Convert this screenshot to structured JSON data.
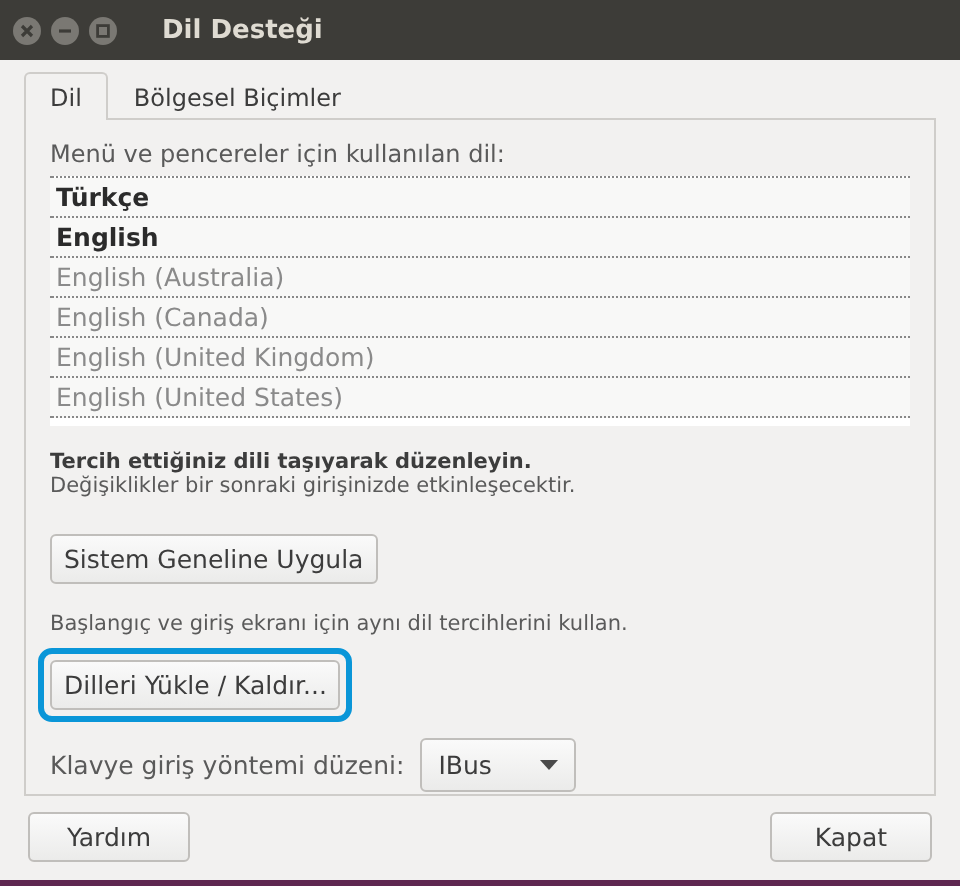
{
  "window": {
    "title": "Dil Desteği"
  },
  "tabs": [
    {
      "label": "Dil",
      "selected": true
    },
    {
      "label": "Bölgesel Biçimler",
      "selected": false
    }
  ],
  "language_list": {
    "label": "Menü ve pencereler için kullanılan dil:",
    "items": [
      {
        "name": "Türkçe",
        "active": true
      },
      {
        "name": "English",
        "active": true
      },
      {
        "name": "English (Australia)",
        "active": false
      },
      {
        "name": "English (Canada)",
        "active": false
      },
      {
        "name": "English (United Kingdom)",
        "active": false
      },
      {
        "name": "English (United States)",
        "active": false
      }
    ]
  },
  "hint": {
    "title": "Tercih ettiğiniz dili taşıyarak düzenleyin.",
    "note": "Değişiklikler bir sonraki girişinizde etkinleşecektir."
  },
  "apply_button": {
    "label": "Sistem Geneline Uygula",
    "highlighted": false
  },
  "apply_note": "Başlangıç ve giriş ekranı için aynı dil tercihlerini kullan.",
  "install_button": {
    "label": "Dilleri Yükle / Kaldır...",
    "highlighted": true
  },
  "input_method": {
    "label": "Klavye giriş yöntemi düzeni:",
    "value": "IBus"
  },
  "buttons": [
    "Yardım",
    "Kapat"
  ]
}
